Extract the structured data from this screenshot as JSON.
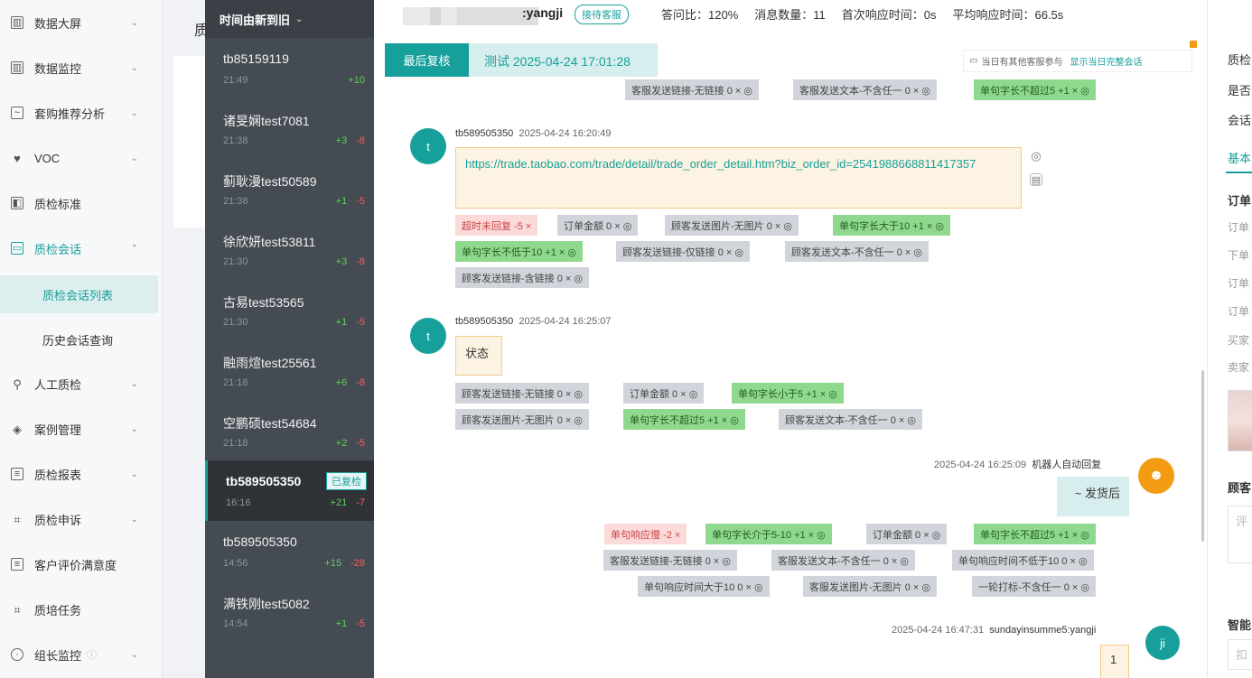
{
  "nav": {
    "items": [
      {
        "label": "数据大屏",
        "icon": "dashboard-icon",
        "chev": "⌄"
      },
      {
        "label": "数据监控",
        "icon": "monitor-icon",
        "chev": "⌄"
      },
      {
        "label": "套购推荐分析",
        "icon": "analysis-icon",
        "chev": "⌄"
      },
      {
        "label": "VOC",
        "icon": "voc-icon",
        "chev": "⌄"
      },
      {
        "label": "质检标准",
        "icon": "standard-icon"
      },
      {
        "label": "质检会话",
        "icon": "chat-icon",
        "chev": "⌃"
      },
      {
        "label": "人工质检",
        "icon": "person-icon",
        "chev": "⌄"
      },
      {
        "label": "案例管理",
        "icon": "layers-icon",
        "chev": "⌄"
      },
      {
        "label": "质检报表",
        "icon": "report-icon",
        "chev": "⌄"
      },
      {
        "label": "质检申诉",
        "icon": "appeal-icon",
        "chev": "⌄"
      },
      {
        "label": "客户评价满意度",
        "icon": "rating-icon"
      },
      {
        "label": "质培任务",
        "icon": "task-icon"
      },
      {
        "label": "组长监控",
        "icon": "clock-icon",
        "chev": "⌄"
      }
    ],
    "sub": [
      "质检会话列表",
      "历史会话查询"
    ]
  },
  "strip": {
    "char": "质"
  },
  "list": {
    "header": "时间由新到旧",
    "sessions": [
      {
        "name": "tb85159119",
        "time": "21:49",
        "pos": "+10",
        "neg": ""
      },
      {
        "name": "诸旻娴test7081",
        "time": "21:38",
        "pos": "+3",
        "neg": "-8"
      },
      {
        "name": "蓟耿漫test50589",
        "time": "21:38",
        "pos": "+1",
        "neg": "-5"
      },
      {
        "name": "徐欣妍test53811",
        "time": "21:30",
        "pos": "+3",
        "neg": "-8"
      },
      {
        "name": "古易test53565",
        "time": "21:30",
        "pos": "+1",
        "neg": "-5"
      },
      {
        "name": "融雨煊test25561",
        "time": "21:18",
        "pos": "+6",
        "neg": "-8"
      },
      {
        "name": "空鹏硕test54684",
        "time": "21:18",
        "pos": "+2",
        "neg": "-5"
      },
      {
        "name": "tb589505350",
        "time": "16:16",
        "pos": "+21",
        "neg": "-7",
        "badge": "已复检"
      },
      {
        "name": "tb589505350",
        "time": "14:56",
        "pos": "+15",
        "neg": "-28"
      },
      {
        "name": "满铁刚test5082",
        "time": "14:54",
        "pos": "+1",
        "neg": "-5"
      }
    ]
  },
  "topbar": {
    "agent": ":yangji",
    "role": "接待客服",
    "stats": [
      "答问比：120%",
      "消息数量：11",
      "首次响应时间：0s",
      "平均响应时间：66.5s"
    ]
  },
  "review": {
    "button": "最后复核",
    "text": "测试  2025-04-24 17:01:28",
    "other_note": "当日有其他客服参与",
    "other_link": "显示当日完整会话"
  },
  "messages": {
    "m1": {
      "sender": "tb589505350",
      "time": "2025-04-24 16:20:49",
      "avatar": "t",
      "content": "https://trade.taobao.com/trade/detail/trade_order_detail.htm?biz_order_id=2541988668811417357"
    },
    "m2": {
      "sender": "tb589505350",
      "time": "2025-04-24 16:25:07",
      "avatar": "t",
      "content": "状态"
    },
    "m3": {
      "sender": "机器人自动回复",
      "time": "2025-04-24 16:25:09",
      "avatar": "bot",
      "content": "~ 发货后"
    },
    "m4": {
      "sender": "sundayinsumme5:yangji",
      "time": "2025-04-24 16:47:31",
      "avatar": "ji",
      "content": "1"
    }
  },
  "tags": {
    "top": [
      "客服发送链接-无链接 0 × ◎",
      "客服发送文本-不含任一 0 × ◎",
      "单句字长不超过5 +1 × ◎"
    ],
    "m1": [
      "超时未回复 -5 ×",
      "订单金额 0 × ◎",
      "顾客发送图片-无图片 0 × ◎",
      "单句字长大于10 +1 × ◎",
      "单句字长不低于10 +1 × ◎",
      "顾客发送链接-仅链接 0 × ◎",
      "顾客发送文本-不含任一 0 × ◎",
      "顾客发送链接-含链接 0 × ◎"
    ],
    "m2": [
      "顾客发送链接-无链接 0 × ◎",
      "订单金额 0 × ◎",
      "单句字长小于5 +1 × ◎",
      "顾客发送图片-无图片 0 × ◎",
      "单句字长不超过5 +1 × ◎",
      "顾客发送文本-不含任一 0 × ◎"
    ],
    "m3": [
      "单句响应慢 -2 ×",
      "单句字长介于5-10 +1 × ◎",
      "订单金额 0 × ◎",
      "单句字长不超过5 +1 × ◎",
      "客服发送链接-无链接 0 × ◎",
      "客服发送文本-不含任一 0 × ◎",
      "单句响应时间不低于10 0 × ◎",
      "单句响应时间大于10 0 × ◎",
      "客服发送图片-无图片 0 × ◎",
      "一轮打标-不含任一 0 × ◎"
    ]
  },
  "right": {
    "lines": [
      "质检",
      "是否",
      "会话",
      "基本",
      "订单",
      "订单",
      "下单",
      "订单",
      "订单",
      "买家",
      "卖家",
      "顾客",
      "评",
      "智能",
      "扣"
    ]
  },
  "colors": {
    "accent": "#17a09b",
    "positive": "#5ed15e",
    "negative": "#ff5a5a",
    "bot": "#f39c12"
  }
}
